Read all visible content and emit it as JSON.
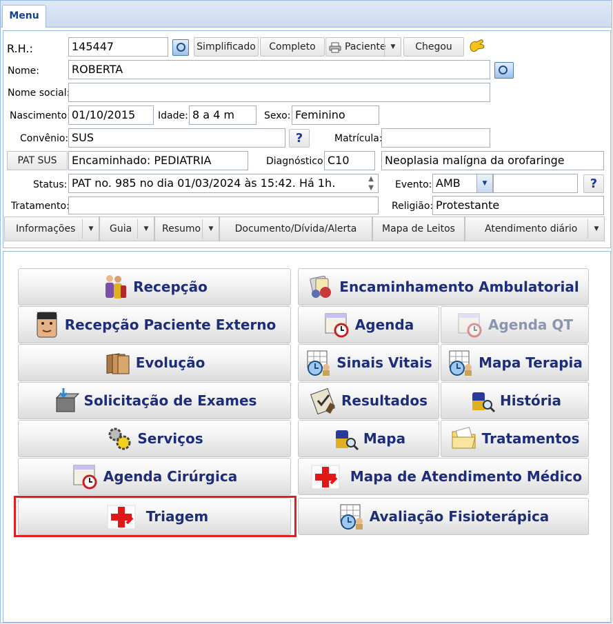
{
  "tab": {
    "label": "Menu"
  },
  "form": {
    "rh": {
      "label": "R.H.:",
      "value": "145447"
    },
    "buttons": {
      "simplificado": "Simplificado",
      "completo": "Completo",
      "paciente": "Paciente",
      "chegou": "Chegou"
    },
    "nome": {
      "label": "Nome:",
      "value": "ROBERTA"
    },
    "nome_social": {
      "label": "Nome social:",
      "value": ""
    },
    "nascimento": {
      "label": "Nascimento:",
      "value": "01/10/2015"
    },
    "idade": {
      "label": "Idade:",
      "value": "8 a 4 m"
    },
    "sexo": {
      "label": "Sexo:",
      "value": "Feminino"
    },
    "convenio": {
      "label": "Convênio:",
      "value": "SUS",
      "help": "?"
    },
    "matricula": {
      "label": "Matrícula:",
      "value": ""
    },
    "pat_sus": {
      "label": "PAT SUS"
    },
    "encaminhado": {
      "value": "Encaminhado: PEDIATRIA"
    },
    "diagnostico": {
      "label": "Diagnóstico:",
      "code": "C10",
      "desc": "Neoplasia malígna da orofaringe"
    },
    "status": {
      "label": "Status:",
      "value": "PAT no. 985 no dia 01/03/2024  às  15:42. Há 1h."
    },
    "evento": {
      "label": "Evento:",
      "value": "AMB",
      "extra": "",
      "help": "?"
    },
    "tratamento": {
      "label": "Tratamento:",
      "value": ""
    },
    "religiao": {
      "label": "Religião:",
      "value": "Protestante"
    }
  },
  "toolbar": {
    "informacoes": "Informações",
    "guia": "Guia",
    "resumo": "Resumo",
    "documento": "Documento/Dívida/Alerta",
    "mapa_leitos": "Mapa de Leitos",
    "atendimento": "Atendimento diário"
  },
  "menu": {
    "recepcao": "Recepção",
    "encaminhamento": "Encaminhamento Ambulatorial",
    "recepcao_externo": "Recepção Paciente Externo",
    "agenda": "Agenda",
    "agenda_qt": "Agenda QT",
    "evolucao": "Evolução",
    "sinais_vitais": "Sinais Vitais",
    "mapa_terapia": "Mapa Terapia",
    "solicitacao": "Solicitação de Exames",
    "resultados": "Resultados",
    "historia": "História",
    "servicos": "Serviços",
    "mapa": "Mapa",
    "tratamentos": "Tratamentos",
    "agenda_cirurgica": "Agenda Cirúrgica",
    "mapa_atendimento": "Mapa de Atendimento Médico",
    "triagem": "Triagem",
    "avaliacao": "Avaliação Fisioterápica"
  },
  "colors": {
    "accent": "#1d2d7a",
    "highlight": "#e02020",
    "border": "#99bbe8"
  }
}
